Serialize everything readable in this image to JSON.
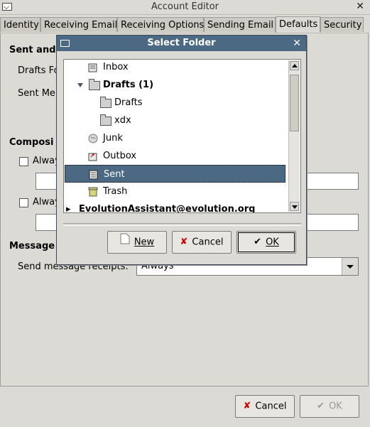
{
  "window": {
    "title": "Account Editor",
    "close": "✕"
  },
  "tabs": [
    {
      "label": "Identity"
    },
    {
      "label": "Receiving Email"
    },
    {
      "label": "Receiving Options"
    },
    {
      "label": "Sending Email"
    },
    {
      "label": "Defaults"
    },
    {
      "label": "Security"
    }
  ],
  "defaults": {
    "sent_drafts_heading": "Sent and",
    "drafts_label": "Drafts Fo",
    "sent_label": "Sent Me",
    "composing_heading": "Composi",
    "always_cc_label": "Alway",
    "always_bcc_label": "Alway",
    "receipts_heading": "Message",
    "send_receipts_label": "Send message receipts:",
    "send_receipts_value": "Always"
  },
  "dialog": {
    "title": "Select Folder",
    "close": "✕",
    "folders": [
      {
        "label": "Inbox",
        "icon": "inbox-icon"
      },
      {
        "label": "Drafts (1)",
        "icon": "folder-icon"
      },
      {
        "label": "Drafts",
        "icon": "folder-icon"
      },
      {
        "label": "xdx",
        "icon": "folder-icon"
      },
      {
        "label": "Junk",
        "icon": "junk-icon"
      },
      {
        "label": "Outbox",
        "icon": "outbox-icon"
      },
      {
        "label": "Sent",
        "icon": "sent-icon"
      },
      {
        "label": "Trash",
        "icon": "trash-icon"
      },
      {
        "label": "EvolutionAssistant@evolution.org",
        "icon": "account-icon"
      }
    ],
    "new_button": "New",
    "cancel_button": "Cancel",
    "ok_button": "OK"
  },
  "footer": {
    "cancel_button": "Cancel",
    "ok_button": "OK"
  },
  "colors": {
    "selection": "#4b6983",
    "background": "#dcdad5"
  }
}
